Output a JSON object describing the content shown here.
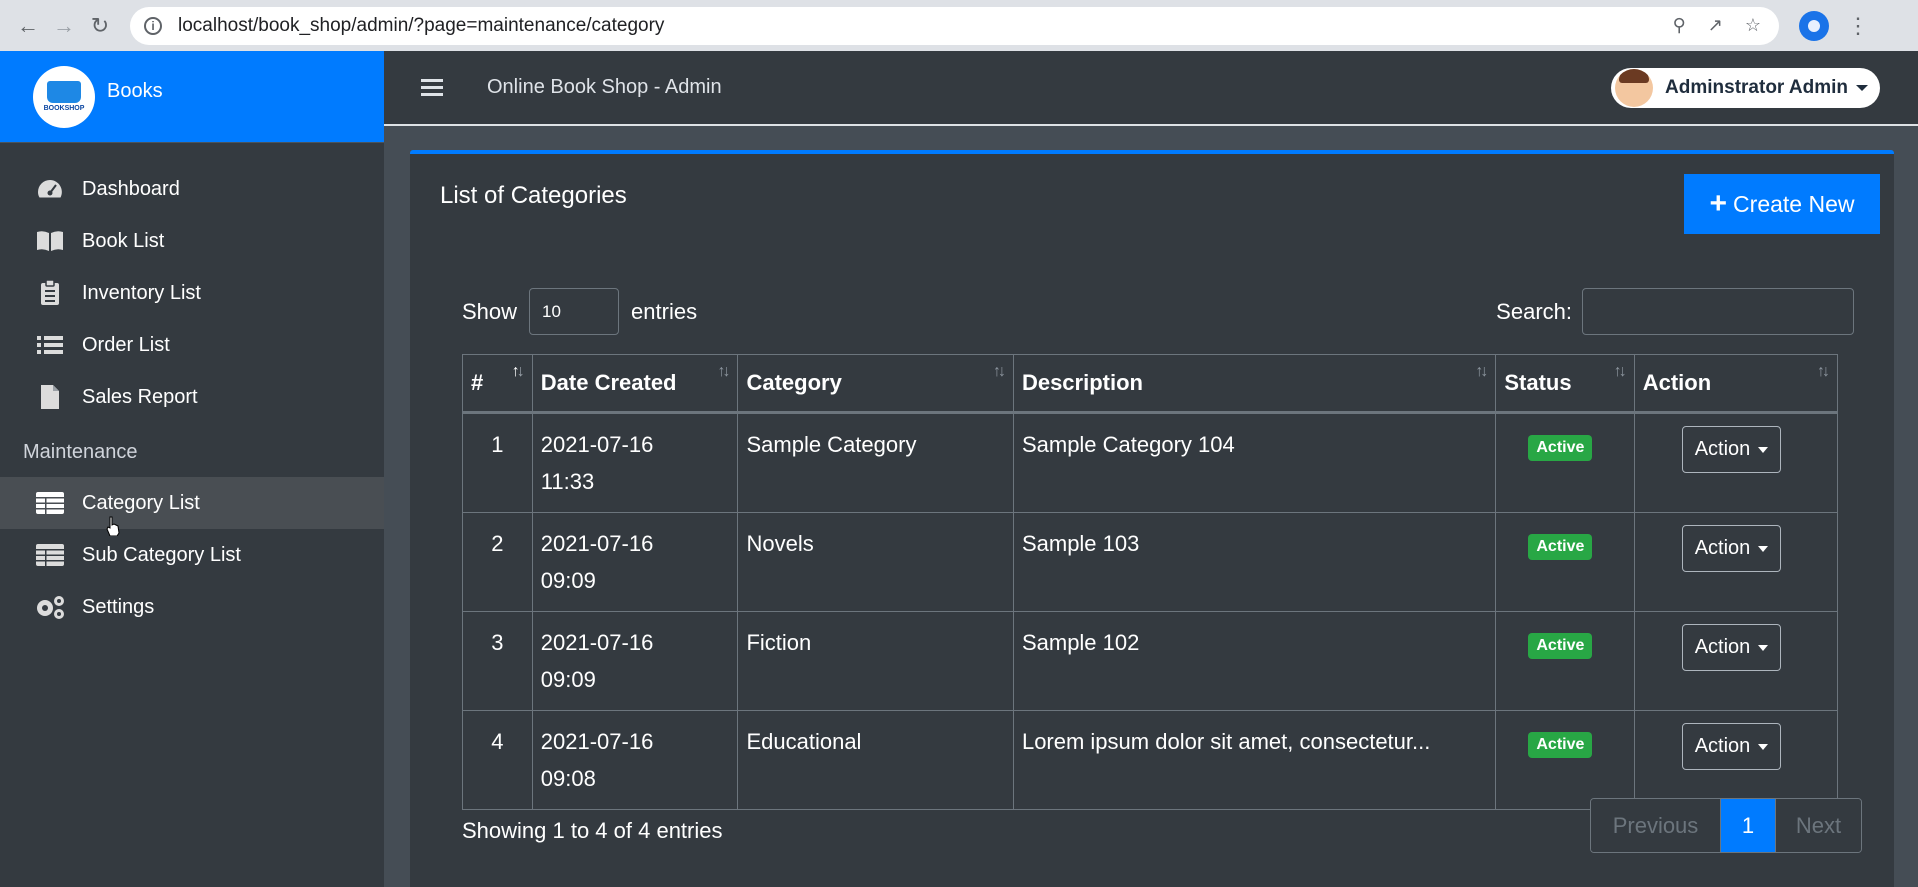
{
  "browser": {
    "url": "localhost/book_shop/admin/?page=maintenance/category"
  },
  "sidebar": {
    "brand": "Books",
    "brand_logo_text": "BOOKSHOP",
    "items": [
      {
        "label": "Dashboard",
        "icon": "tachometer-icon"
      },
      {
        "label": "Book List",
        "icon": "book-icon"
      },
      {
        "label": "Inventory List",
        "icon": "clipboard-icon"
      },
      {
        "label": "Order List",
        "icon": "list-icon"
      },
      {
        "label": "Sales Report",
        "icon": "file-icon"
      }
    ],
    "section_header": "Maintenance",
    "maintenance_items": [
      {
        "label": "Category List",
        "icon": "table-icon",
        "active": true
      },
      {
        "label": "Sub Category List",
        "icon": "table-icon"
      },
      {
        "label": "Settings",
        "icon": "cogs-icon"
      }
    ]
  },
  "topbar": {
    "title": "Online Book Shop - Admin",
    "user": "Adminstrator Admin"
  },
  "card": {
    "title": "List of Categories",
    "create_label": "Create New"
  },
  "table_controls": {
    "show_label": "Show",
    "entries_value": "10",
    "entries_label": "entries",
    "search_label": "Search:"
  },
  "table": {
    "headers": [
      "#",
      "Date Created",
      "Category",
      "Description",
      "Status",
      "Action"
    ],
    "rows": [
      {
        "num": "1",
        "date": "2021-07-16",
        "time": "11:33",
        "category": "Sample Category",
        "description": "Sample Category 104",
        "status": "Active",
        "action": "Action"
      },
      {
        "num": "2",
        "date": "2021-07-16",
        "time": "09:09",
        "category": "Novels",
        "description": "Sample 103",
        "status": "Active",
        "action": "Action"
      },
      {
        "num": "3",
        "date": "2021-07-16",
        "time": "09:09",
        "category": "Fiction",
        "description": "Sample 102",
        "status": "Active",
        "action": "Action"
      },
      {
        "num": "4",
        "date": "2021-07-16",
        "time": "09:08",
        "category": "Educational",
        "description": "Lorem ipsum dolor sit amet, consectetur...",
        "status": "Active",
        "action": "Action"
      }
    ]
  },
  "footer": {
    "info": "Showing 1 to 4 of 4 entries",
    "prev": "Previous",
    "page": "1",
    "next": "Next"
  },
  "colors": {
    "primary": "#007bff",
    "success": "#28a745",
    "dark": "#343a40"
  }
}
